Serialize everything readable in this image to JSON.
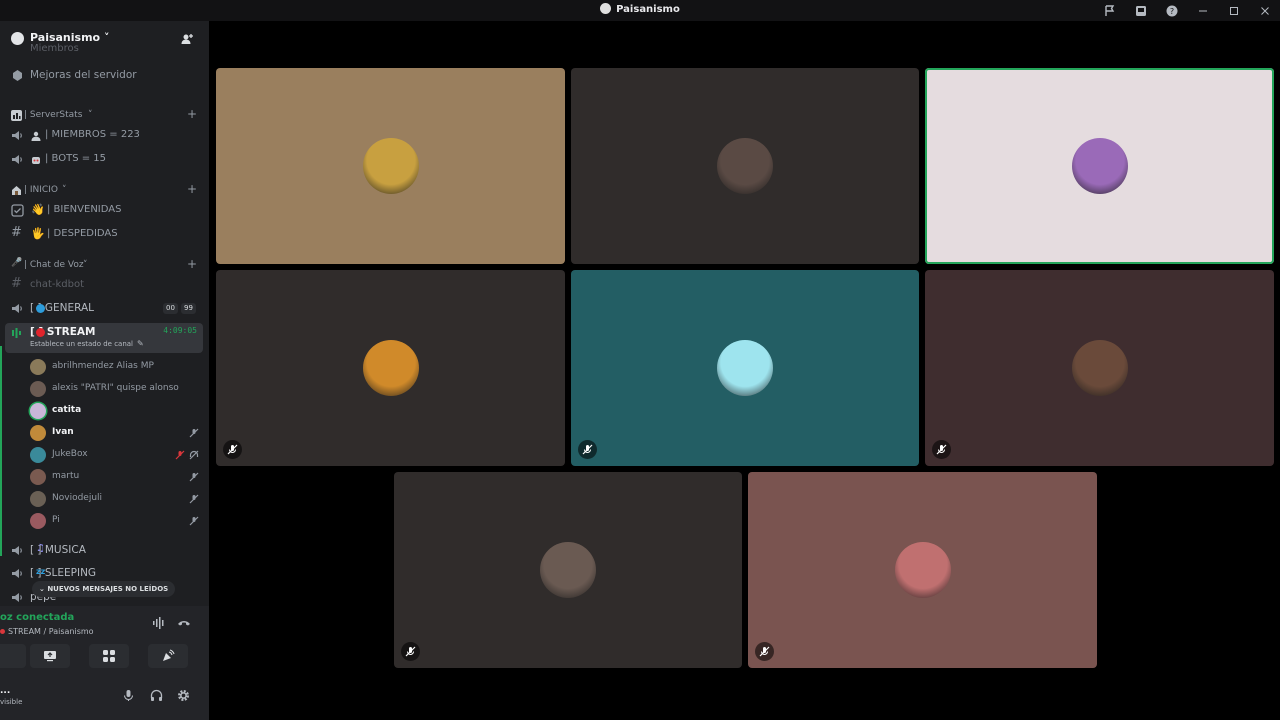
{
  "window": {
    "title": "Paisanismo"
  },
  "server": {
    "name": "Paisanismo"
  },
  "sidebar": {
    "partial_top": "Miembros",
    "boosts": "Mejoras del servidor",
    "categories": {
      "stats": "| ServerStats",
      "inicio": "| INICIO",
      "voz": "| Chat de Voz"
    },
    "channels": {
      "miembros": "| MIEMBROS = 223",
      "bots": "| BOTS = 15",
      "bienvenidas": "| BIENVENIDAS",
      "despedidas": "| DESPEDIDAS",
      "kdbot": "chat-kdbot",
      "general": "[ ] GENERAL",
      "general_badge1": "00",
      "general_badge2": "99",
      "stream": "[ ] STREAM",
      "stream_timer": "4:09:05",
      "stream_sub": "Establece un estado de canal",
      "musica": "[ ] MUSICA",
      "sleeping": "[ ] SLEEPING",
      "partial_bottom": "pepe"
    },
    "users": [
      {
        "name": "abrilhmendez Alias MP",
        "color": "#8a7a5a"
      },
      {
        "name": "alexis \"PATRI\" quispe alonso",
        "color": "#6b5b53"
      },
      {
        "name": "catita",
        "color": "#c9b6d8"
      },
      {
        "name": "Ivan",
        "color": "#c08a3a"
      },
      {
        "name": "JukeBox",
        "color": "#3a8a9a"
      },
      {
        "name": "martu",
        "color": "#7a5a50"
      },
      {
        "name": "Noviodejuli",
        "color": "#6a6055"
      },
      {
        "name": "Pi",
        "color": "#9a5a60"
      }
    ],
    "unread_pill": "NUEVOS MENSAJES NO LEÍDOS"
  },
  "voice_panel": {
    "status": "oz conectada",
    "location": "STREAM / Paisanismo",
    "username": "...",
    "user_status": "visible"
  },
  "tiles": [
    {
      "bg": "#9a7f5e",
      "avatar": "#c8a040",
      "muted": false,
      "speaking": false
    },
    {
      "bg": "#302c2b",
      "avatar": "#5a4a44",
      "muted": false,
      "speaking": false
    },
    {
      "bg": "#e5dcdf",
      "avatar": "#9a6ab8",
      "muted": false,
      "speaking": true
    },
    {
      "bg": "#302c2b",
      "avatar": "#d08a2a",
      "muted": true,
      "speaking": false
    },
    {
      "bg": "#235e64",
      "avatar": "#9ee4ee",
      "muted": true,
      "speaking": false
    },
    {
      "bg": "#3f2d2f",
      "avatar": "#6a4a3a",
      "muted": true,
      "speaking": false
    },
    {
      "bg": "#302c2b",
      "avatar": "#6a5a52",
      "muted": true,
      "speaking": false
    },
    {
      "bg": "#7a5450",
      "avatar": "#c07070",
      "muted": true,
      "speaking": false
    }
  ],
  "colors": {
    "accent_green": "#23a55a",
    "sidebar": "#1e1f22",
    "stage": "#000000"
  }
}
